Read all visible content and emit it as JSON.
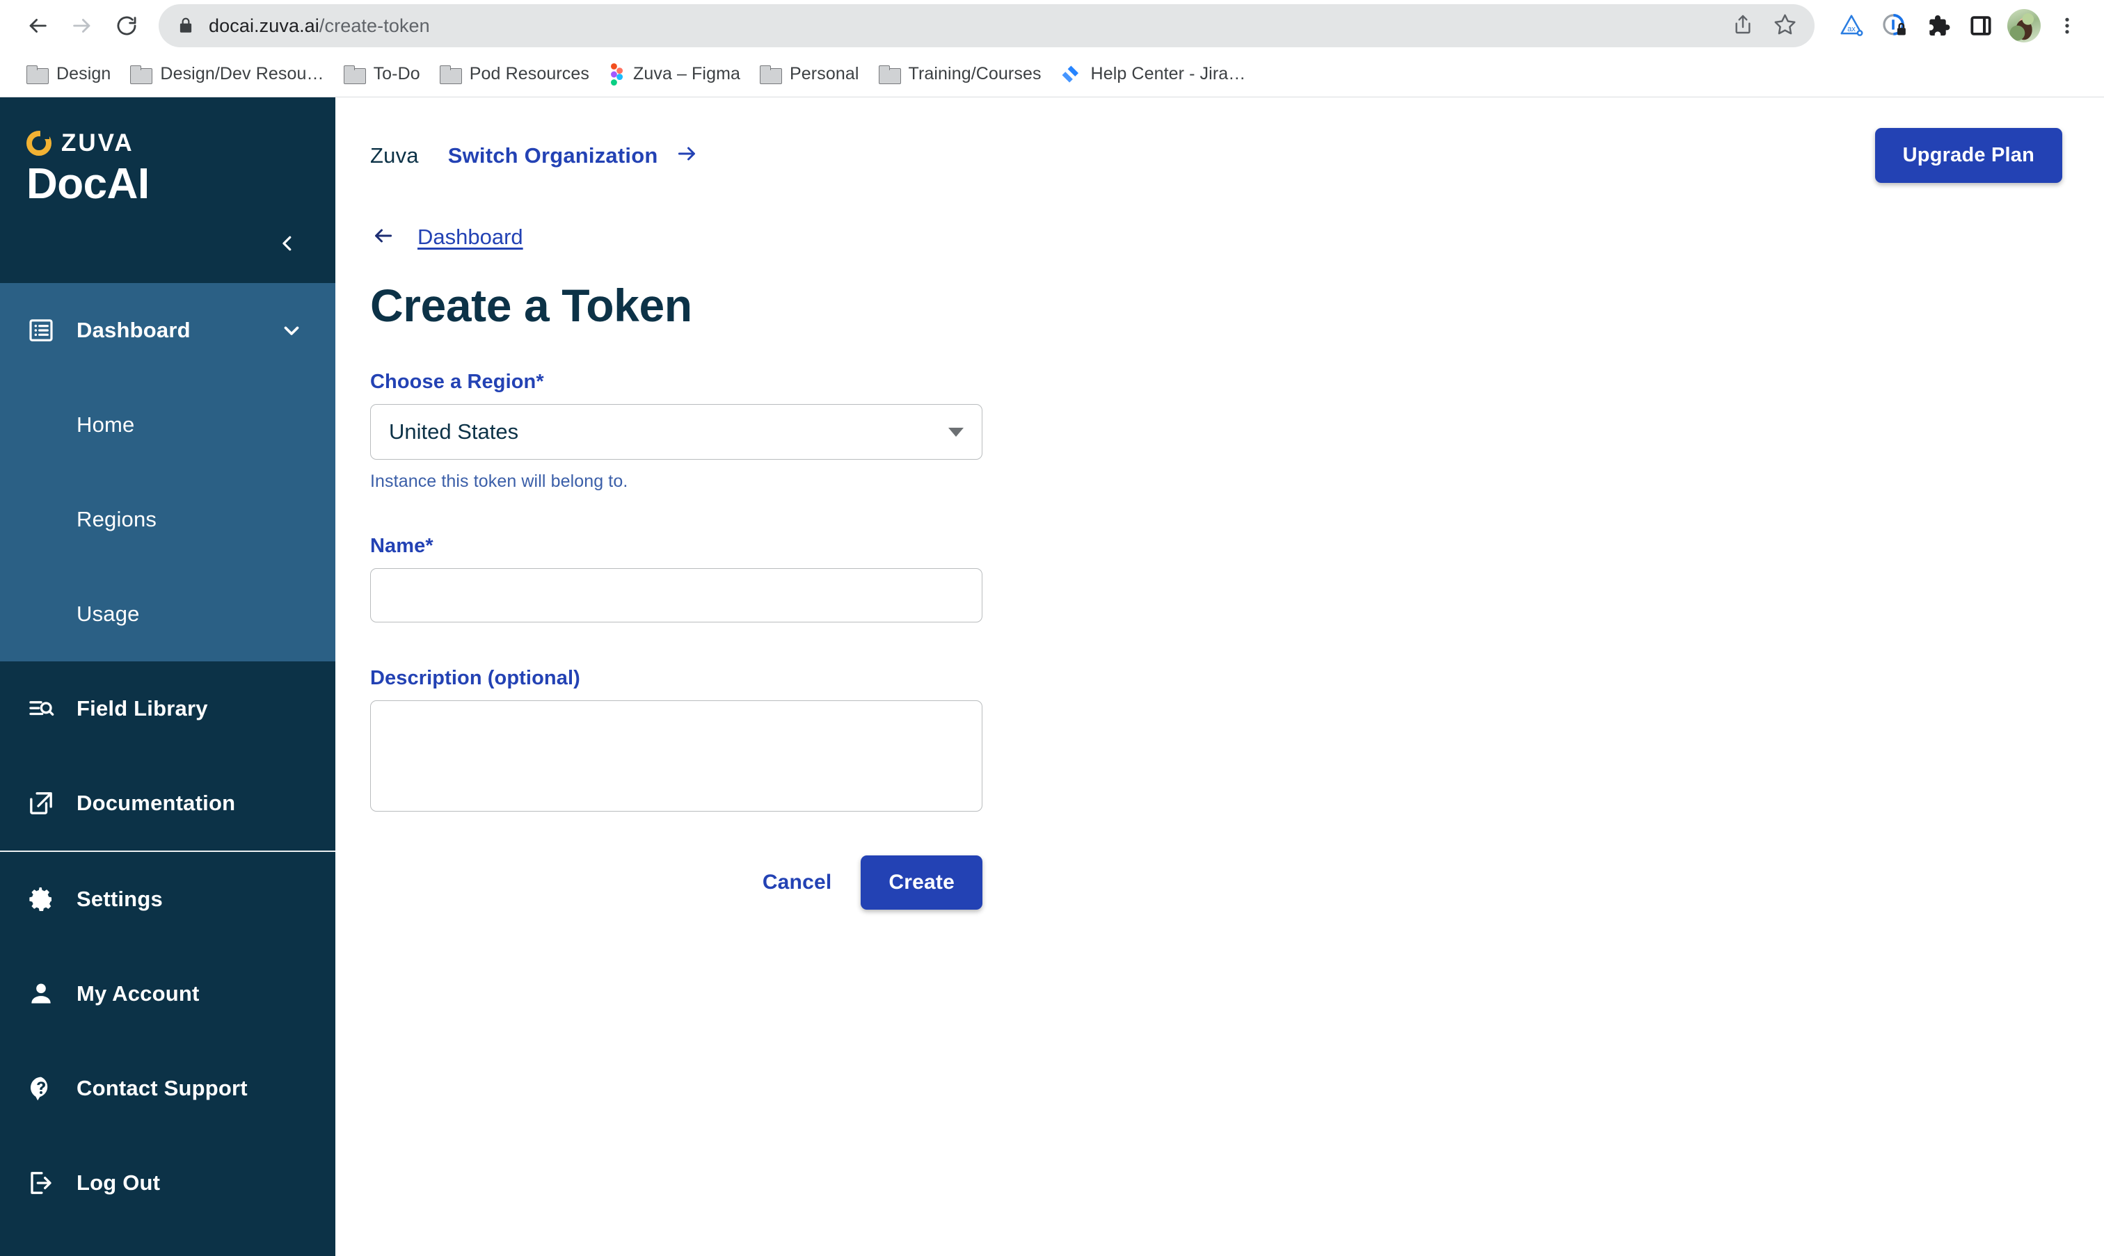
{
  "browser": {
    "url_host": "docai.zuva.ai",
    "url_path": "/create-token",
    "back_label": "Back",
    "forward_label": "Forward",
    "reload_label": "Reload",
    "share_label": "Share",
    "bookmark_label": "Bookmark this tab",
    "axe_label": "axe DevTools",
    "privacy_label": "Privacy Badger",
    "extensions_label": "Extensions",
    "sidepanel_label": "Side panel",
    "profile_label": "Profile",
    "menu_label": "Customize and control Google Chrome",
    "bookmarks": [
      {
        "label": "Design",
        "icon": "folder-icon"
      },
      {
        "label": "Design/Dev Resou…",
        "icon": "folder-icon"
      },
      {
        "label": "To-Do",
        "icon": "folder-icon"
      },
      {
        "label": "Pod Resources",
        "icon": "folder-icon"
      },
      {
        "label": "Zuva – Figma",
        "icon": "figma-icon"
      },
      {
        "label": "Personal",
        "icon": "folder-icon"
      },
      {
        "label": "Training/Courses",
        "icon": "folder-icon"
      },
      {
        "label": "Help Center - Jira…",
        "icon": "jira-icon"
      }
    ]
  },
  "sidebar": {
    "brand_word": "ZUVA",
    "brand_product": "DocAI",
    "collapse_label": "Collapse sidebar",
    "groups": [
      {
        "label": "Dashboard",
        "icon": "list-box-icon",
        "expanded": true,
        "children": [
          {
            "label": "Home"
          },
          {
            "label": "Regions"
          },
          {
            "label": "Usage"
          }
        ]
      }
    ],
    "middle_items": [
      {
        "label": "Field Library",
        "icon": "list-search-icon"
      },
      {
        "label": "Documentation",
        "icon": "external-link-icon"
      }
    ],
    "bottom_items": [
      {
        "label": "Settings",
        "icon": "gear-icon"
      },
      {
        "label": "My Account",
        "icon": "person-icon"
      },
      {
        "label": "Contact Support",
        "icon": "help-circle-icon"
      },
      {
        "label": "Log Out",
        "icon": "logout-icon"
      }
    ]
  },
  "header": {
    "organization": "Zuva",
    "switch_organization": "Switch Organization",
    "upgrade_plan": "Upgrade Plan"
  },
  "page": {
    "breadcrumb": "Dashboard",
    "title": "Create a Token"
  },
  "form": {
    "region": {
      "label": "Choose a Region",
      "required_mark": "*",
      "value": "United States",
      "helper": "Instance this token will belong to.",
      "options": [
        "United States"
      ]
    },
    "name": {
      "label": "Name",
      "required_mark": "*",
      "value": "",
      "placeholder": ""
    },
    "description": {
      "label": "Description (optional)",
      "value": "",
      "placeholder": ""
    },
    "cancel_label": "Cancel",
    "create_label": "Create"
  },
  "colors": {
    "sidebar_bg": "#0c3247",
    "sidebar_active": "#2b6085",
    "accent_blue": "#2342b4",
    "brand_gold": "#f2b233",
    "navy_text": "#0c3247"
  }
}
